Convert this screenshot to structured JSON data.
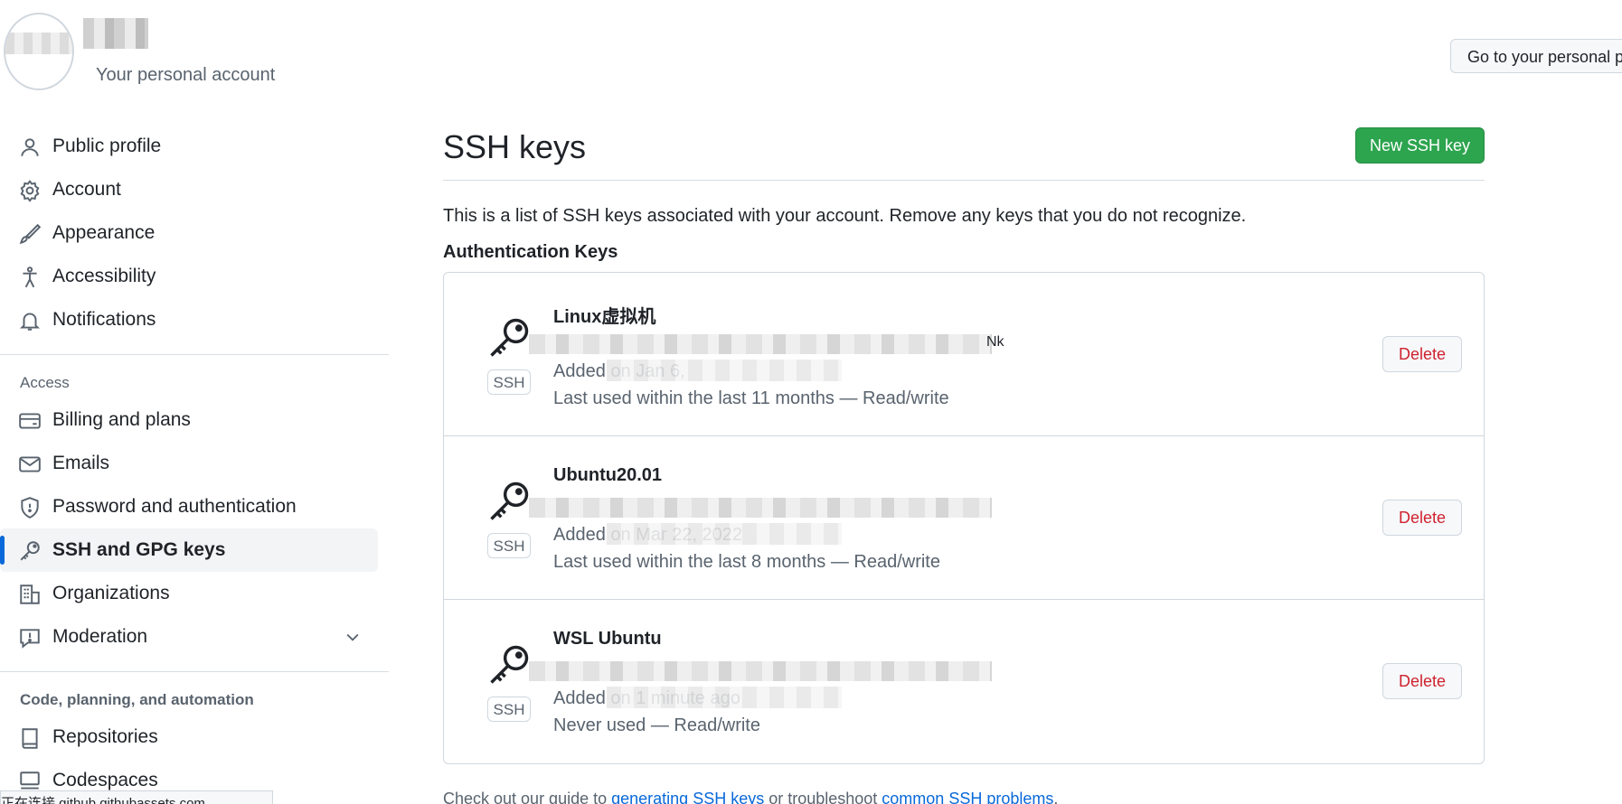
{
  "header": {
    "account_subtitle": "Your personal account",
    "go_personal_label": "Go to your personal profile"
  },
  "sidebar": {
    "items_top": [
      {
        "label": "Public profile",
        "icon": "person-icon"
      },
      {
        "label": "Account",
        "icon": "gear-icon"
      },
      {
        "label": "Appearance",
        "icon": "paintbrush-icon"
      },
      {
        "label": "Accessibility",
        "icon": "accessibility-icon"
      },
      {
        "label": "Notifications",
        "icon": "bell-icon"
      }
    ],
    "access_heading": "Access",
    "items_access": [
      {
        "label": "Billing and plans",
        "icon": "credit-card-icon"
      },
      {
        "label": "Emails",
        "icon": "mail-icon"
      },
      {
        "label": "Password and authentication",
        "icon": "shield-icon"
      },
      {
        "label": "SSH and GPG keys",
        "icon": "key-icon",
        "active": true
      },
      {
        "label": "Organizations",
        "icon": "organization-icon"
      },
      {
        "label": "Moderation",
        "icon": "report-icon"
      }
    ],
    "code_heading": "Code, planning, and automation",
    "items_code": [
      {
        "label": "Repositories",
        "icon": "repo-icon"
      },
      {
        "label": "Codespaces",
        "icon": "codespaces-icon"
      }
    ]
  },
  "main": {
    "title": "SSH keys",
    "new_key_label": "New SSH key",
    "description": "This is a list of SSH keys associated with your account. Remove any keys that you do not recognize.",
    "subheading": "Authentication Keys",
    "keys": [
      {
        "name": "Linux虚拟机",
        "type": "SSH",
        "fingerprint_tail": "Nk",
        "added": "Added on Jan 6,",
        "last_used": "Last used within the last 11 months — Read/write",
        "delete_label": "Delete"
      },
      {
        "name": "Ubuntu20.01",
        "type": "SSH",
        "fingerprint_tail": "",
        "added": "Added on Mar 22, 2022",
        "last_used": "Last used within the last 8 months — Read/write",
        "delete_label": "Delete"
      },
      {
        "name": "WSL Ubuntu",
        "type": "SSH",
        "fingerprint_tail": "",
        "added": "Added on 1 minute ago",
        "last_used": "Never used — Read/write",
        "delete_label": "Delete"
      }
    ],
    "footer": {
      "prefix": "Check out our guide to ",
      "link1": "generating SSH keys",
      "middle": " or troubleshoot ",
      "link2": "common SSH problems",
      "suffix": "."
    }
  },
  "status_bar": "正在连接 github.githubassets.com..."
}
